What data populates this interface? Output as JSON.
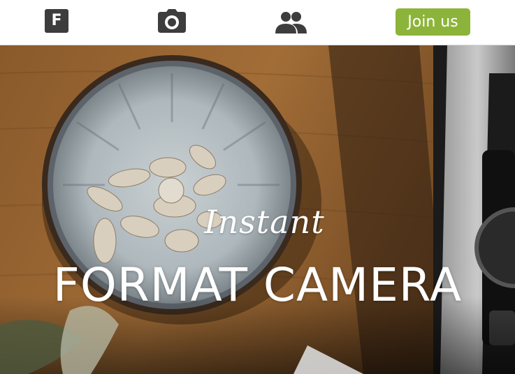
{
  "nav": {
    "logo_letter": "F",
    "join_label": "Join us",
    "icons": [
      "logo-icon",
      "camera-icon",
      "people-icon"
    ]
  },
  "hero": {
    "subtitle": "Instant",
    "title": "FORMAT CAMERA"
  },
  "colors": {
    "accent": "#8db43a",
    "icon": "#3d3d3d",
    "hero_text": "#ffffff"
  }
}
